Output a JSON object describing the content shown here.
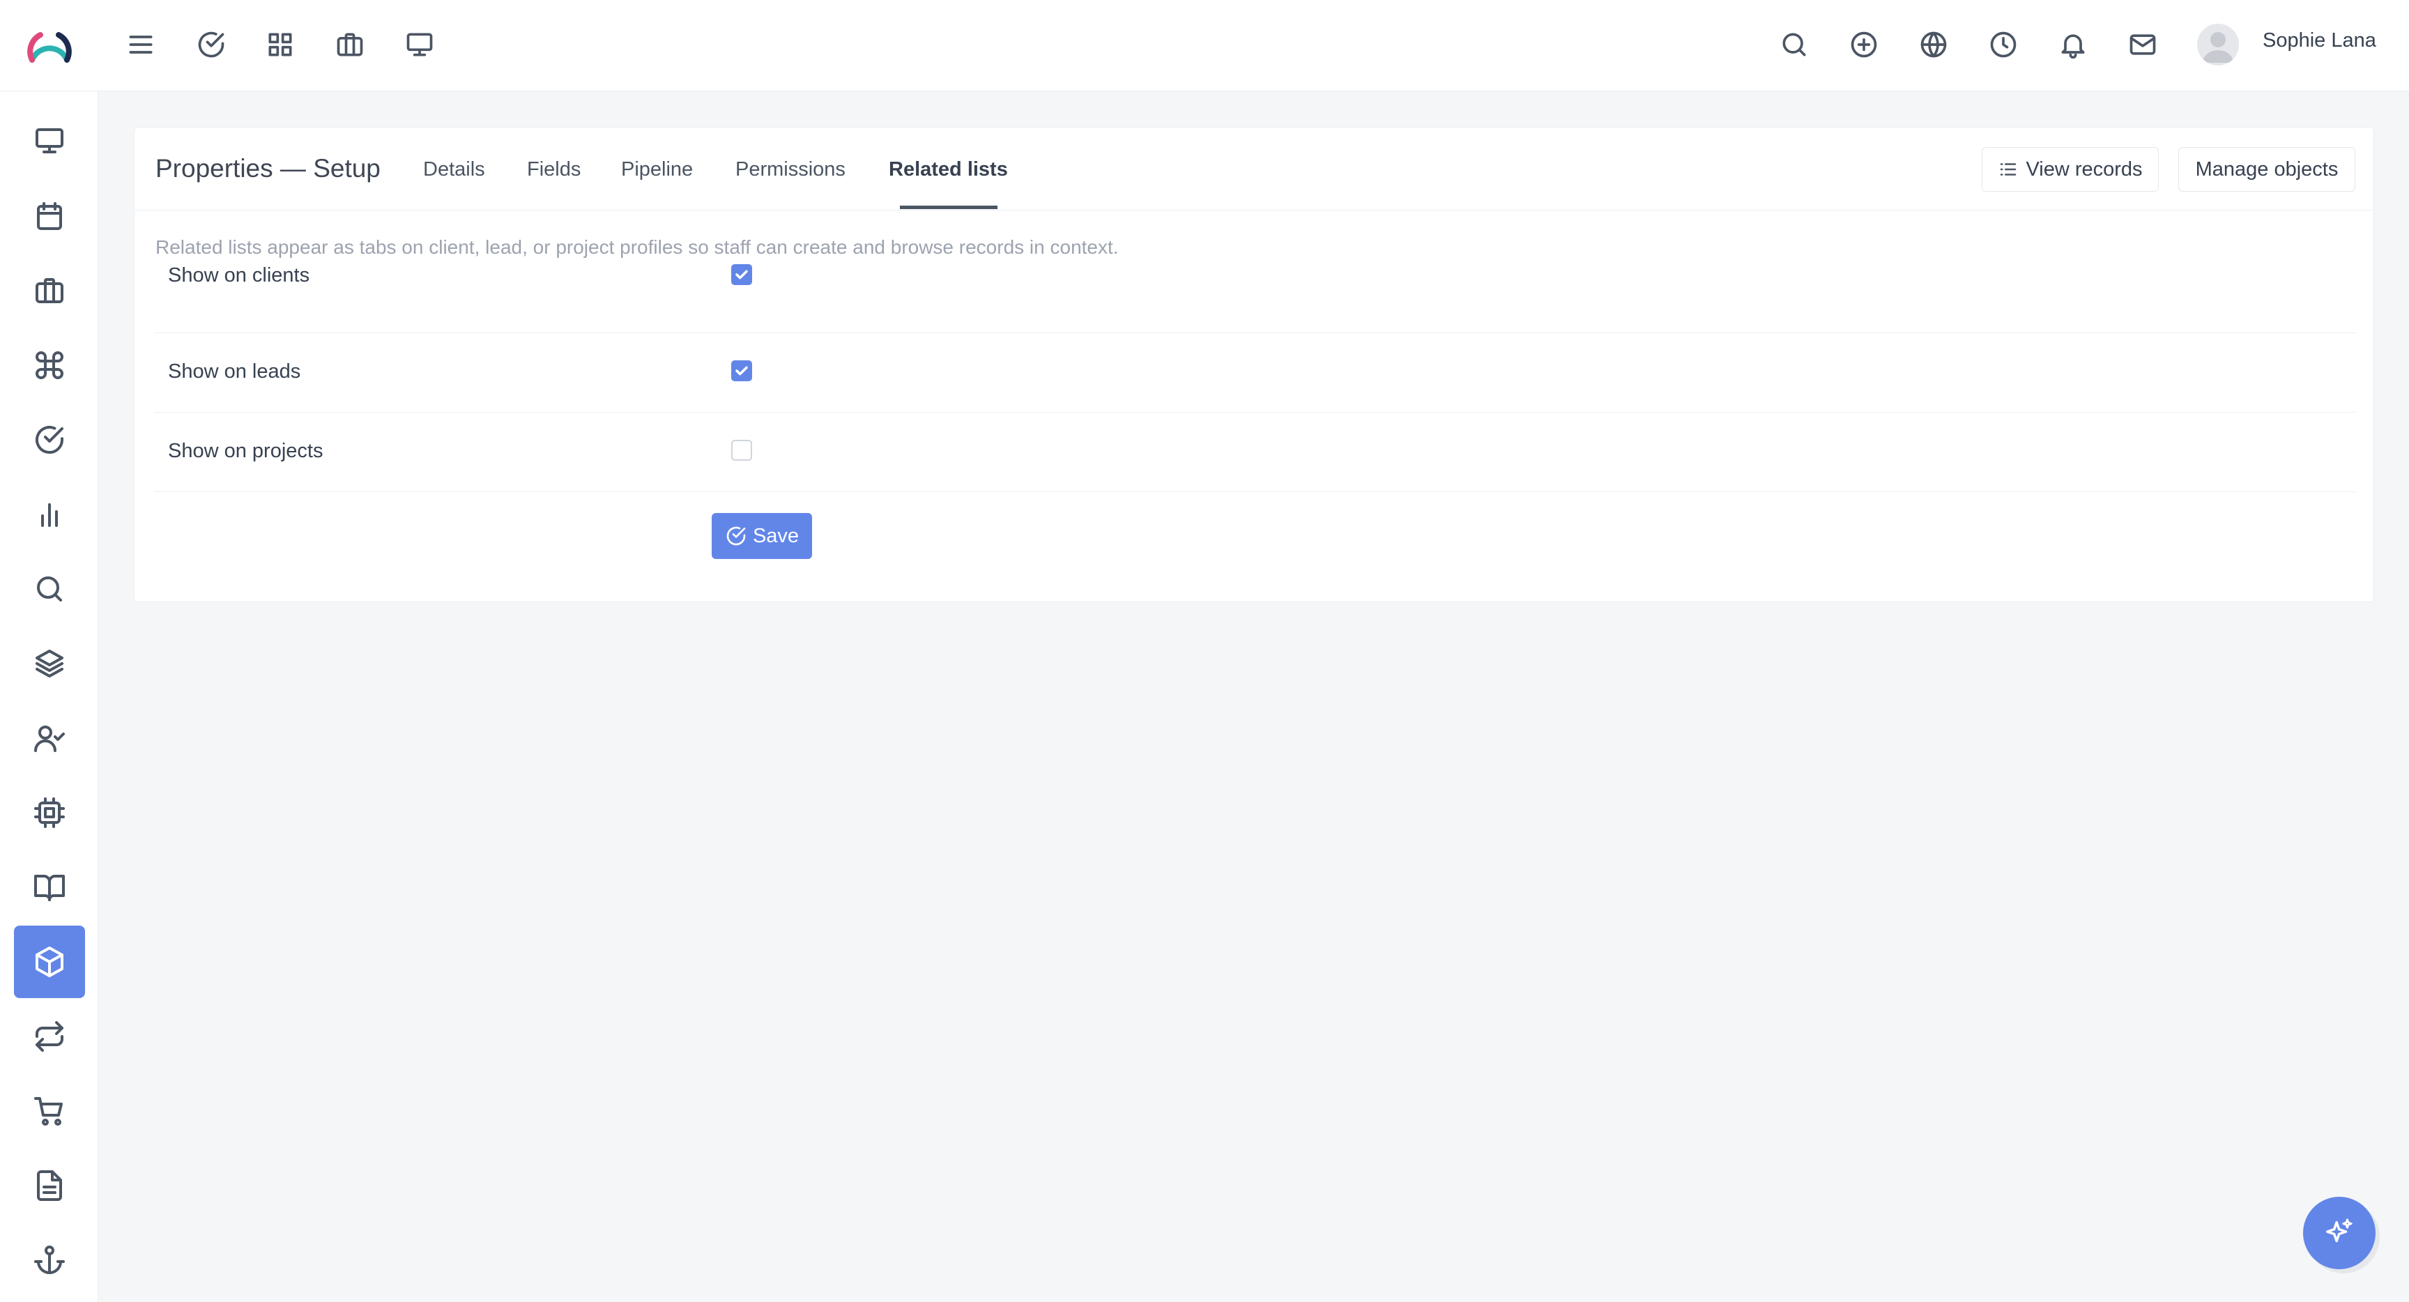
{
  "header": {
    "user_name": "Sophie Lana",
    "left_icons": [
      "menu-icon",
      "check-circle-icon",
      "grid-icon",
      "briefcase-icon",
      "monitor-icon"
    ],
    "right_icons": [
      "search-icon",
      "plus-circle-icon",
      "globe-icon",
      "clock-icon",
      "bell-icon",
      "mail-icon"
    ]
  },
  "sidebar": {
    "items": [
      {
        "icon": "monitor-icon"
      },
      {
        "icon": "calendar-icon"
      },
      {
        "icon": "briefcase-icon"
      },
      {
        "icon": "command-icon"
      },
      {
        "icon": "check-circle-icon"
      },
      {
        "icon": "bar-chart-icon"
      },
      {
        "icon": "search-icon"
      },
      {
        "icon": "layers-icon"
      },
      {
        "icon": "user-check-icon"
      },
      {
        "icon": "cpu-icon"
      },
      {
        "icon": "book-open-icon"
      },
      {
        "icon": "box-icon",
        "active": true
      },
      {
        "icon": "repeat-icon"
      },
      {
        "icon": "shopping-cart-icon"
      },
      {
        "icon": "file-text-icon"
      },
      {
        "icon": "anchor-icon"
      }
    ]
  },
  "page": {
    "title": "Properties — Setup",
    "tabs": [
      {
        "label": "Details"
      },
      {
        "label": "Fields"
      },
      {
        "label": "Pipeline"
      },
      {
        "label": "Permissions"
      },
      {
        "label": "Related lists",
        "active": true
      }
    ],
    "view_records_label": "View records",
    "manage_objects_label": "Manage objects",
    "description": "Related lists appear as tabs on client, lead, or project profiles so staff can create and browse records in context.",
    "options": [
      {
        "label": "Show on clients",
        "checked": true
      },
      {
        "label": "Show on leads",
        "checked": true
      },
      {
        "label": "Show on projects",
        "checked": false
      }
    ],
    "save_label": "Save"
  },
  "colors": {
    "accent": "#6286e8",
    "background": "#f5f6f8",
    "text": "#374151",
    "muted": "#9ca3af"
  }
}
